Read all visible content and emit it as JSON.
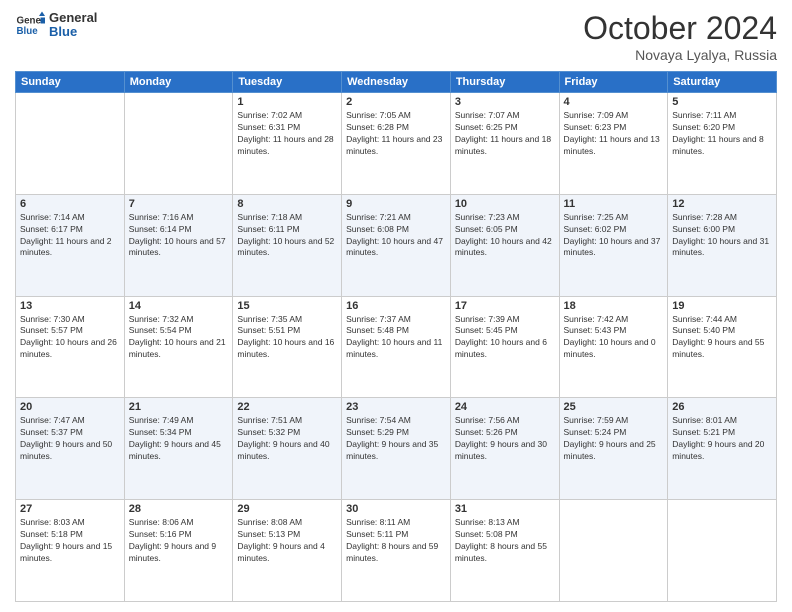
{
  "header": {
    "logo_line1": "General",
    "logo_line2": "Blue",
    "month": "October 2024",
    "location": "Novaya Lyalya, Russia"
  },
  "weekdays": [
    "Sunday",
    "Monday",
    "Tuesday",
    "Wednesday",
    "Thursday",
    "Friday",
    "Saturday"
  ],
  "weeks": [
    [
      {
        "day": "",
        "sunrise": "",
        "sunset": "",
        "daylight": ""
      },
      {
        "day": "",
        "sunrise": "",
        "sunset": "",
        "daylight": ""
      },
      {
        "day": "1",
        "sunrise": "Sunrise: 7:02 AM",
        "sunset": "Sunset: 6:31 PM",
        "daylight": "Daylight: 11 hours and 28 minutes."
      },
      {
        "day": "2",
        "sunrise": "Sunrise: 7:05 AM",
        "sunset": "Sunset: 6:28 PM",
        "daylight": "Daylight: 11 hours and 23 minutes."
      },
      {
        "day": "3",
        "sunrise": "Sunrise: 7:07 AM",
        "sunset": "Sunset: 6:25 PM",
        "daylight": "Daylight: 11 hours and 18 minutes."
      },
      {
        "day": "4",
        "sunrise": "Sunrise: 7:09 AM",
        "sunset": "Sunset: 6:23 PM",
        "daylight": "Daylight: 11 hours and 13 minutes."
      },
      {
        "day": "5",
        "sunrise": "Sunrise: 7:11 AM",
        "sunset": "Sunset: 6:20 PM",
        "daylight": "Daylight: 11 hours and 8 minutes."
      }
    ],
    [
      {
        "day": "6",
        "sunrise": "Sunrise: 7:14 AM",
        "sunset": "Sunset: 6:17 PM",
        "daylight": "Daylight: 11 hours and 2 minutes."
      },
      {
        "day": "7",
        "sunrise": "Sunrise: 7:16 AM",
        "sunset": "Sunset: 6:14 PM",
        "daylight": "Daylight: 10 hours and 57 minutes."
      },
      {
        "day": "8",
        "sunrise": "Sunrise: 7:18 AM",
        "sunset": "Sunset: 6:11 PM",
        "daylight": "Daylight: 10 hours and 52 minutes."
      },
      {
        "day": "9",
        "sunrise": "Sunrise: 7:21 AM",
        "sunset": "Sunset: 6:08 PM",
        "daylight": "Daylight: 10 hours and 47 minutes."
      },
      {
        "day": "10",
        "sunrise": "Sunrise: 7:23 AM",
        "sunset": "Sunset: 6:05 PM",
        "daylight": "Daylight: 10 hours and 42 minutes."
      },
      {
        "day": "11",
        "sunrise": "Sunrise: 7:25 AM",
        "sunset": "Sunset: 6:02 PM",
        "daylight": "Daylight: 10 hours and 37 minutes."
      },
      {
        "day": "12",
        "sunrise": "Sunrise: 7:28 AM",
        "sunset": "Sunset: 6:00 PM",
        "daylight": "Daylight: 10 hours and 31 minutes."
      }
    ],
    [
      {
        "day": "13",
        "sunrise": "Sunrise: 7:30 AM",
        "sunset": "Sunset: 5:57 PM",
        "daylight": "Daylight: 10 hours and 26 minutes."
      },
      {
        "day": "14",
        "sunrise": "Sunrise: 7:32 AM",
        "sunset": "Sunset: 5:54 PM",
        "daylight": "Daylight: 10 hours and 21 minutes."
      },
      {
        "day": "15",
        "sunrise": "Sunrise: 7:35 AM",
        "sunset": "Sunset: 5:51 PM",
        "daylight": "Daylight: 10 hours and 16 minutes."
      },
      {
        "day": "16",
        "sunrise": "Sunrise: 7:37 AM",
        "sunset": "Sunset: 5:48 PM",
        "daylight": "Daylight: 10 hours and 11 minutes."
      },
      {
        "day": "17",
        "sunrise": "Sunrise: 7:39 AM",
        "sunset": "Sunset: 5:45 PM",
        "daylight": "Daylight: 10 hours and 6 minutes."
      },
      {
        "day": "18",
        "sunrise": "Sunrise: 7:42 AM",
        "sunset": "Sunset: 5:43 PM",
        "daylight": "Daylight: 10 hours and 0 minutes."
      },
      {
        "day": "19",
        "sunrise": "Sunrise: 7:44 AM",
        "sunset": "Sunset: 5:40 PM",
        "daylight": "Daylight: 9 hours and 55 minutes."
      }
    ],
    [
      {
        "day": "20",
        "sunrise": "Sunrise: 7:47 AM",
        "sunset": "Sunset: 5:37 PM",
        "daylight": "Daylight: 9 hours and 50 minutes."
      },
      {
        "day": "21",
        "sunrise": "Sunrise: 7:49 AM",
        "sunset": "Sunset: 5:34 PM",
        "daylight": "Daylight: 9 hours and 45 minutes."
      },
      {
        "day": "22",
        "sunrise": "Sunrise: 7:51 AM",
        "sunset": "Sunset: 5:32 PM",
        "daylight": "Daylight: 9 hours and 40 minutes."
      },
      {
        "day": "23",
        "sunrise": "Sunrise: 7:54 AM",
        "sunset": "Sunset: 5:29 PM",
        "daylight": "Daylight: 9 hours and 35 minutes."
      },
      {
        "day": "24",
        "sunrise": "Sunrise: 7:56 AM",
        "sunset": "Sunset: 5:26 PM",
        "daylight": "Daylight: 9 hours and 30 minutes."
      },
      {
        "day": "25",
        "sunrise": "Sunrise: 7:59 AM",
        "sunset": "Sunset: 5:24 PM",
        "daylight": "Daylight: 9 hours and 25 minutes."
      },
      {
        "day": "26",
        "sunrise": "Sunrise: 8:01 AM",
        "sunset": "Sunset: 5:21 PM",
        "daylight": "Daylight: 9 hours and 20 minutes."
      }
    ],
    [
      {
        "day": "27",
        "sunrise": "Sunrise: 8:03 AM",
        "sunset": "Sunset: 5:18 PM",
        "daylight": "Daylight: 9 hours and 15 minutes."
      },
      {
        "day": "28",
        "sunrise": "Sunrise: 8:06 AM",
        "sunset": "Sunset: 5:16 PM",
        "daylight": "Daylight: 9 hours and 9 minutes."
      },
      {
        "day": "29",
        "sunrise": "Sunrise: 8:08 AM",
        "sunset": "Sunset: 5:13 PM",
        "daylight": "Daylight: 9 hours and 4 minutes."
      },
      {
        "day": "30",
        "sunrise": "Sunrise: 8:11 AM",
        "sunset": "Sunset: 5:11 PM",
        "daylight": "Daylight: 8 hours and 59 minutes."
      },
      {
        "day": "31",
        "sunrise": "Sunrise: 8:13 AM",
        "sunset": "Sunset: 5:08 PM",
        "daylight": "Daylight: 8 hours and 55 minutes."
      },
      {
        "day": "",
        "sunrise": "",
        "sunset": "",
        "daylight": ""
      },
      {
        "day": "",
        "sunrise": "",
        "sunset": "",
        "daylight": ""
      }
    ]
  ]
}
